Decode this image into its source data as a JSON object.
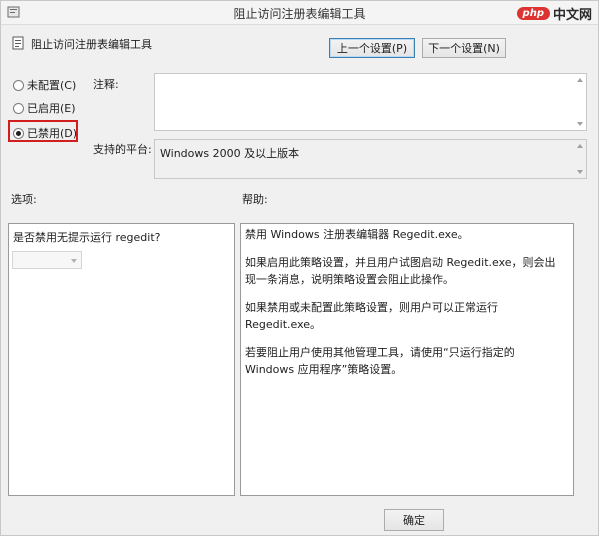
{
  "window": {
    "title": "阻止访问注册表编辑工具",
    "watermark_badge": "php",
    "watermark_text": "中文网"
  },
  "policy": {
    "name": "阻止访问注册表编辑工具"
  },
  "nav": {
    "prev_label": "上一个设置(P)",
    "next_label": "下一个设置(N)"
  },
  "state": {
    "options": [
      {
        "label": "未配置(C)",
        "checked": false
      },
      {
        "label": "已启用(E)",
        "checked": false
      },
      {
        "label": "已禁用(D)",
        "checked": true
      }
    ]
  },
  "comment": {
    "label": "注释:",
    "value": ""
  },
  "supported": {
    "label": "支持的平台:",
    "value": "Windows 2000 及以上版本"
  },
  "options_section": {
    "heading": "选项:",
    "question": "是否禁用无提示运行 regedit?",
    "combo_value": ""
  },
  "help_section": {
    "heading": "帮助:",
    "paragraphs": [
      "禁用 Windows 注册表编辑器 Regedit.exe。",
      "如果启用此策略设置，并且用户试图启动 Regedit.exe，则会出现一条消息，说明策略设置会阻止此操作。",
      "如果禁用或未配置此策略设置，则用户可以正常运行 Regedit.exe。",
      "若要阻止用户使用其他管理工具，请使用“只运行指定的 Windows 应用程序”策略设置。"
    ]
  },
  "footer": {
    "ok_label": "确定"
  },
  "colors": {
    "highlight": "#d11f1f",
    "focus_border": "#3c7fb1"
  }
}
